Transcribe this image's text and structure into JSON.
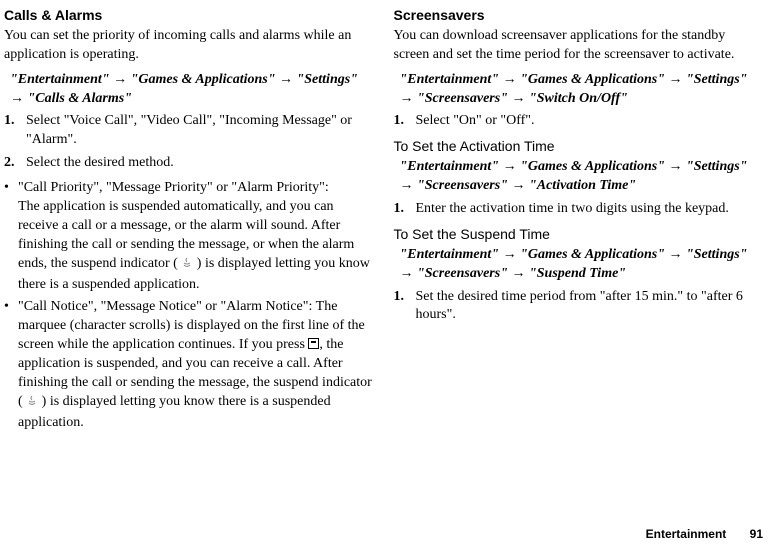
{
  "left": {
    "title": "Calls & Alarms",
    "intro": "You can set the priority of incoming calls and alarms while an application is operating.",
    "path_parts": [
      "\"Entertainment\"",
      "\"Games & Applications\"",
      "\"Settings\"",
      "\"Calls & Alarms\""
    ],
    "step1": "Select \"Voice Call\", \"Video Call\", \"Incoming Message\" or \"Alarm\".",
    "step2": "Select the desired method.",
    "bullet1_head": "\"Call Priority\", \"Message Priority\" or \"Alarm Priority\":",
    "bullet1_body_a": "The application is suspended automatically, and you can receive a call or a message, or the alarm will sound. After finishing the call or sending the message, or when the alarm ends, the suspend indicator (",
    "bullet1_body_b": ") is displayed letting you know there is a suspended application.",
    "bullet2_head": "\"Call Notice\", \"Message Notice\" or \"Alarm Notice\":",
    "bullet2_body_a": "The marquee (character scrolls) is displayed on the first line of the screen while the application continues. If you press ",
    "bullet2_body_b": ", the application is suspended, and you can receive a call. After finishing the call or sending the message, the suspend indicator (",
    "bullet2_body_c": ") is displayed letting you know there is a suspended application."
  },
  "right": {
    "title": "Screensavers",
    "intro": "You can download screensaver applications for the standby screen and set the time period for the screensaver to activate.",
    "path1_parts": [
      "\"Entertainment\"",
      "\"Games & Applications\"",
      "\"Settings\"",
      "\"Screensavers\"",
      "\"Switch On/Off\""
    ],
    "step1": "Select \"On\" or \"Off\".",
    "sub1": "To Set the Activation Time",
    "path2_parts": [
      "\"Entertainment\"",
      "\"Games & Applications\"",
      "\"Settings\"",
      "\"Screensavers\"",
      "\"Activation Time\""
    ],
    "step2": "Enter the activation time in two digits using the keypad.",
    "sub2": "To Set the Suspend Time",
    "path3_parts": [
      "\"Entertainment\"",
      "\"Games & Applications\"",
      "\"Settings\"",
      "\"Screensavers\"",
      "\"Suspend Time\""
    ],
    "step3": "Set the desired time period from \"after 15 min.\" to \"after 6 hours\"."
  },
  "footer": {
    "chapter": "Entertainment",
    "page": "91"
  }
}
